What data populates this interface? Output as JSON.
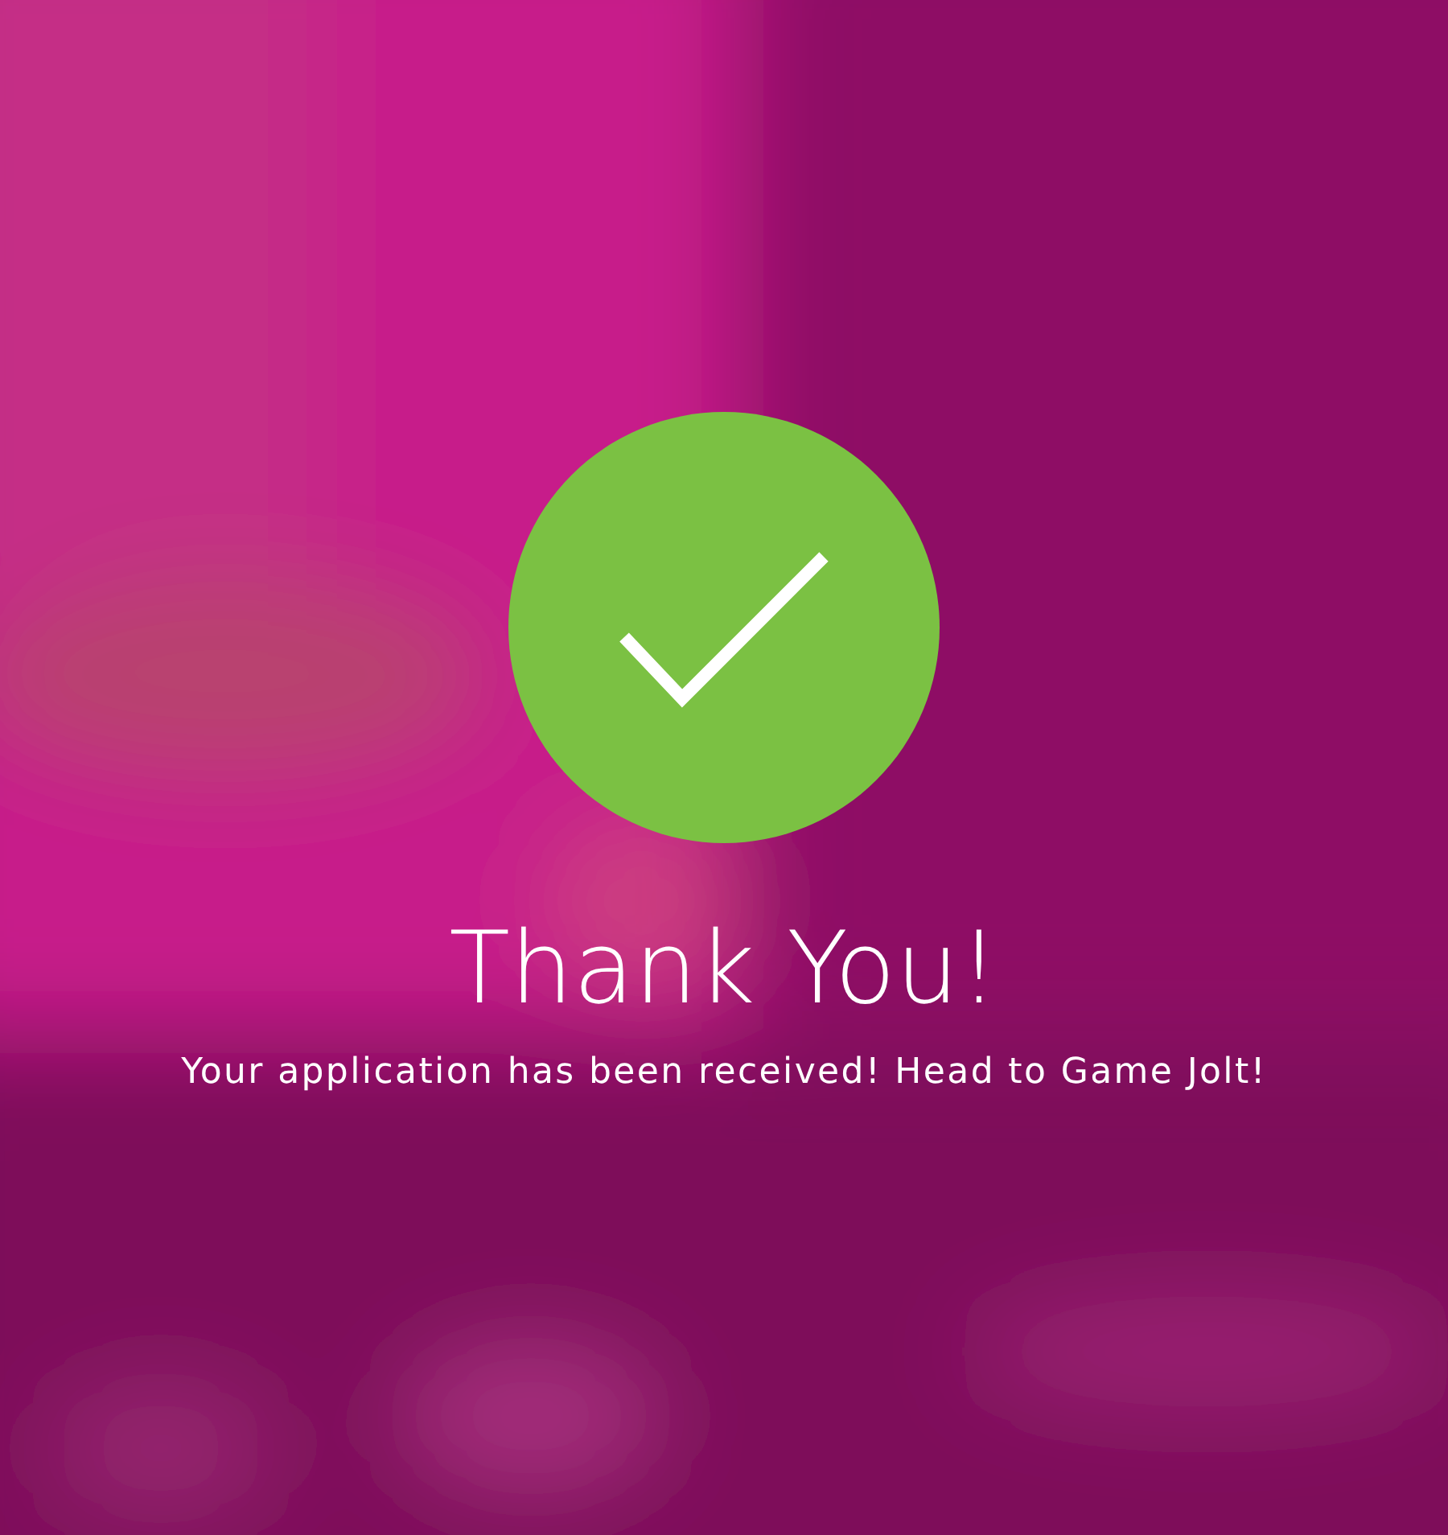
{
  "title": "Thank You!",
  "message": "Your application has been received! Head to Game Jolt!"
}
